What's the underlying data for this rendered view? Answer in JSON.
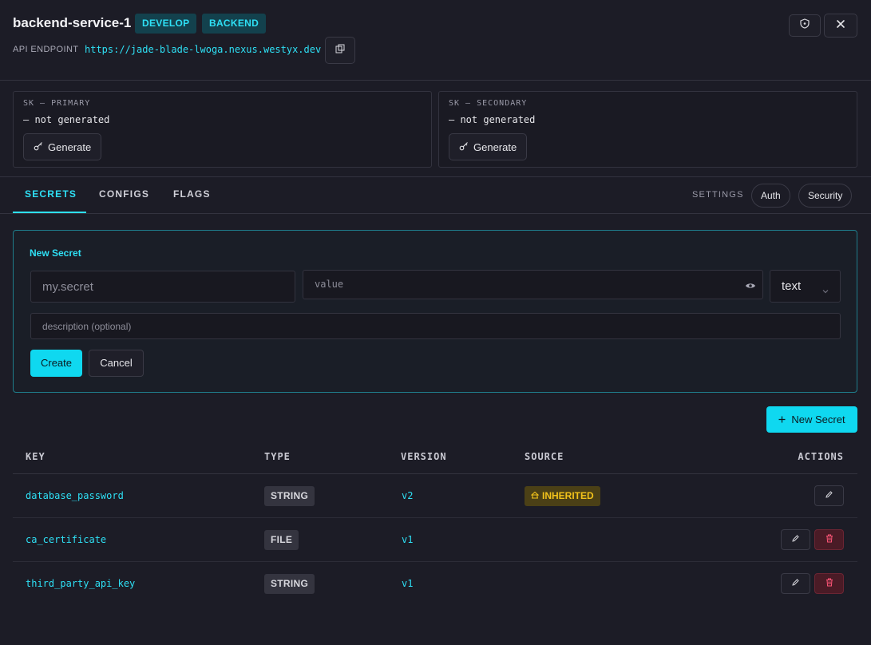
{
  "header": {
    "title": "backend-service-1",
    "badges": [
      "DEVELOP",
      "BACKEND"
    ],
    "api_label": "API ENDPOINT",
    "api_url": "https://jade-blade-lwoga.nexus.westyx.dev"
  },
  "keys": {
    "primary": {
      "label": "SK — PRIMARY",
      "value": "— not generated",
      "button": "Generate"
    },
    "secondary": {
      "label": "SK — SECONDARY",
      "value": "— not generated",
      "button": "Generate"
    }
  },
  "tabs": {
    "items": [
      "SECRETS",
      "CONFIGS",
      "FLAGS"
    ],
    "active": "SECRETS",
    "settings_label": "SETTINGS",
    "settings_buttons": [
      "Auth",
      "Security"
    ]
  },
  "form": {
    "title": "New Secret",
    "key_placeholder": "my.secret",
    "value_placeholder": "value",
    "type_value": "text",
    "description_placeholder": "description (optional)",
    "create_label": "Create",
    "cancel_label": "Cancel"
  },
  "new_secret_button": "New Secret",
  "table": {
    "columns": [
      "KEY",
      "TYPE",
      "VERSION",
      "SOURCE",
      "ACTIONS"
    ],
    "rows": [
      {
        "key": "database_password",
        "type": "STRING",
        "version": "v2",
        "source": "INHERITED"
      },
      {
        "key": "ca_certificate",
        "type": "FILE",
        "version": "v1",
        "source": ""
      },
      {
        "key": "third_party_api_key",
        "type": "STRING",
        "version": "v1",
        "source": ""
      }
    ]
  },
  "colors": {
    "accent": "#0fd8f0",
    "background": "#1c1c26",
    "inherited": "#f2c21b",
    "danger": "#ff5577"
  }
}
